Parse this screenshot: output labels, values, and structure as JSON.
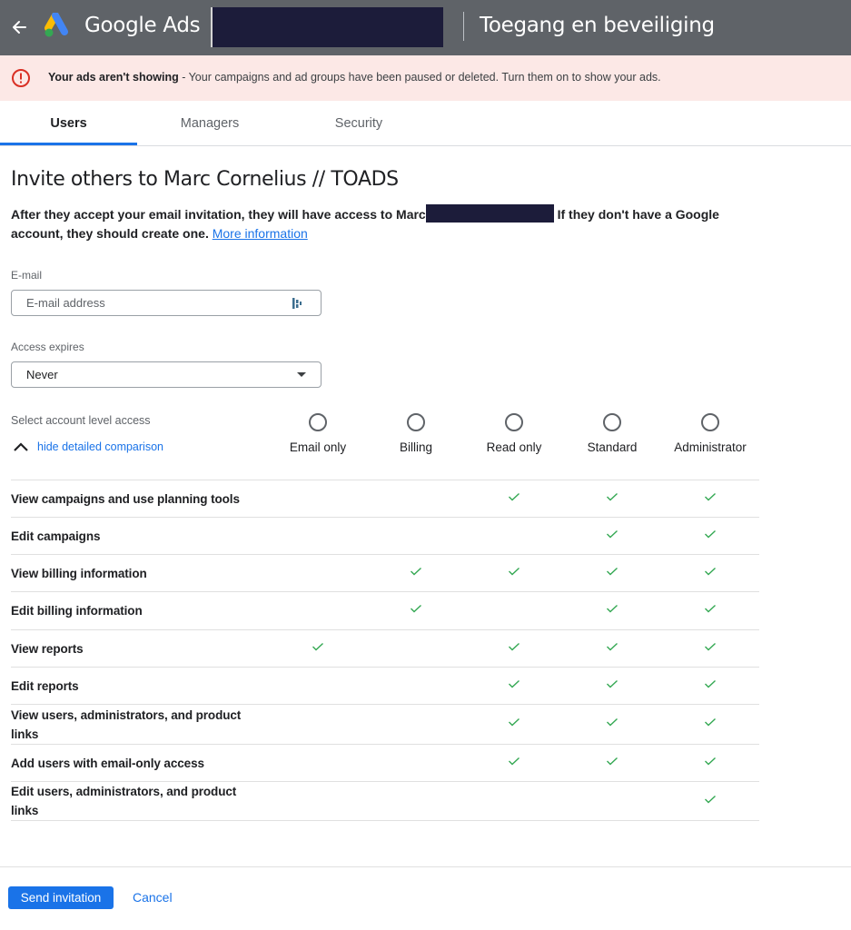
{
  "header": {
    "brand_google": "Google",
    "brand_ads": "Ads",
    "page_title": "Toegang en beveiliging"
  },
  "alert": {
    "bold": "Your ads aren't showing",
    "message": " - Your campaigns and ad groups have been paused or deleted. Turn them on to show your ads."
  },
  "tabs": [
    {
      "label": "Users",
      "active": true
    },
    {
      "label": "Managers",
      "active": false
    },
    {
      "label": "Security",
      "active": false
    }
  ],
  "invite": {
    "title": "Invite others to Marc Cornelius // TOADS",
    "desc_part1": "After they accept your email invitation, they will have access to Marc",
    "desc_part2": "If they don't have a Google account, they should create one.",
    "more_info": "More information"
  },
  "email": {
    "label": "E-mail",
    "placeholder": "E-mail address"
  },
  "expires": {
    "label": "Access expires",
    "value": "Never"
  },
  "access": {
    "label": "Select account level access",
    "toggle": "hide detailed comparison",
    "levels": [
      "Email only",
      "Billing",
      "Read only",
      "Standard",
      "Administrator"
    ]
  },
  "permissions": [
    {
      "label": "View campaigns and use planning tools",
      "checks": [
        false,
        false,
        true,
        true,
        true
      ]
    },
    {
      "label": "Edit campaigns",
      "checks": [
        false,
        false,
        false,
        true,
        true
      ]
    },
    {
      "label": "View billing information",
      "checks": [
        false,
        true,
        true,
        true,
        true
      ]
    },
    {
      "label": "Edit billing information",
      "checks": [
        false,
        true,
        false,
        true,
        true
      ]
    },
    {
      "label": "View reports",
      "checks": [
        true,
        false,
        true,
        true,
        true
      ]
    },
    {
      "label": "Edit reports",
      "checks": [
        false,
        false,
        true,
        true,
        true
      ]
    },
    {
      "label": "View users, administrators, and product links",
      "checks": [
        false,
        false,
        true,
        true,
        true
      ]
    },
    {
      "label": "Add users with email-only access",
      "checks": [
        false,
        false,
        true,
        true,
        true
      ]
    },
    {
      "label": "Edit users, administrators, and product links",
      "checks": [
        false,
        false,
        false,
        false,
        true
      ]
    }
  ],
  "actions": {
    "send": "Send invitation",
    "cancel": "Cancel"
  },
  "colors": {
    "header_bg": "#5f6368",
    "alert_bg": "#fce8e6",
    "accent": "#1a73e8",
    "check": "#34a853",
    "error": "#d93025"
  }
}
